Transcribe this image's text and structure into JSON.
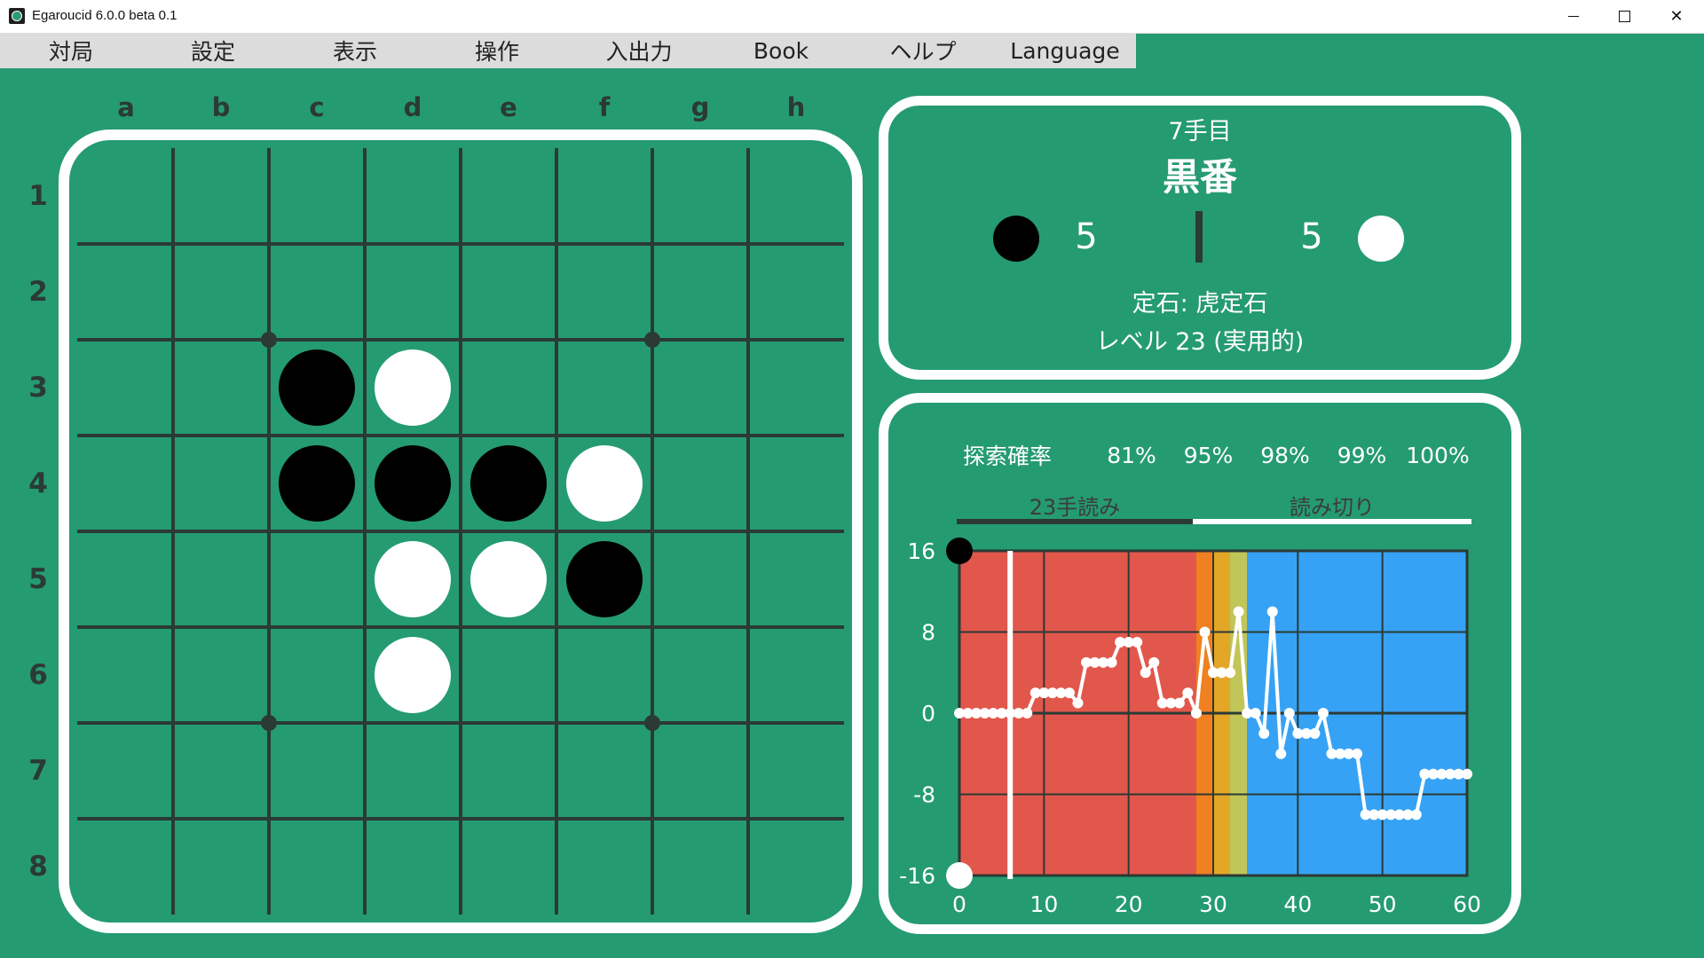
{
  "window": {
    "title": "Egaroucid 6.0.0 beta 0.1",
    "minimize_glyph": "—",
    "maximize_glyph": "☐",
    "close_glyph": "✕"
  },
  "menu": [
    "対局",
    "設定",
    "表示",
    "操作",
    "入出力",
    "Book",
    "ヘルプ",
    "Language"
  ],
  "board": {
    "columns": [
      "a",
      "b",
      "c",
      "d",
      "e",
      "f",
      "g",
      "h"
    ],
    "rows": [
      "1",
      "2",
      "3",
      "4",
      "5",
      "6",
      "7",
      "8"
    ],
    "discs": [
      {
        "cell": "c3",
        "color": "black"
      },
      {
        "cell": "d3",
        "color": "white"
      },
      {
        "cell": "c4",
        "color": "black"
      },
      {
        "cell": "d4",
        "color": "black"
      },
      {
        "cell": "e4",
        "color": "black"
      },
      {
        "cell": "f4",
        "color": "white"
      },
      {
        "cell": "d5",
        "color": "white"
      },
      {
        "cell": "e5",
        "color": "white"
      },
      {
        "cell": "f5",
        "color": "black"
      },
      {
        "cell": "d6",
        "color": "white"
      }
    ],
    "star_points": [
      "c3",
      "g3",
      "c7",
      "g7"
    ]
  },
  "info": {
    "move_number": "7手目",
    "turn": "黒番",
    "black_count": "5",
    "separator": "|",
    "white_count": "5",
    "opening": "定石: 虎定石",
    "level": "レベル 23 (実用的)"
  },
  "legend": [
    {
      "label": "探索確率",
      "color": "#333333"
    },
    {
      "label": "81%",
      "color": "#e2574c"
    },
    {
      "label": "95%",
      "color": "#f08020"
    },
    {
      "label": "98%",
      "color": "#e3a626"
    },
    {
      "label": "99%",
      "color": "#c2c557"
    },
    {
      "label": "100%",
      "color": "#36a2f5"
    }
  ],
  "tabs": [
    {
      "label": "23手読み",
      "active": false
    },
    {
      "label": "読み切り",
      "active": true
    }
  ],
  "colors": {
    "background": "#259b71",
    "grid": "#2b3a34",
    "board_frame": "#ffffff"
  },
  "chart_data": {
    "type": "line",
    "xlim": [
      0,
      60
    ],
    "ylim": [
      -16,
      16
    ],
    "xticks": [
      "0",
      "10",
      "20",
      "30",
      "40",
      "50",
      "60"
    ],
    "yticks": [
      "16",
      "8",
      "0",
      "-8",
      "-16"
    ],
    "current_move": 6,
    "bands": [
      {
        "from": 0,
        "to": 28,
        "color": "#e2574c"
      },
      {
        "from": 28,
        "to": 30,
        "color": "#f08020"
      },
      {
        "from": 30,
        "to": 32,
        "color": "#e3a626"
      },
      {
        "from": 32,
        "to": 34,
        "color": "#c2c557"
      },
      {
        "from": 34,
        "to": 60,
        "color": "#36a2f5"
      }
    ],
    "series": [
      {
        "x": [
          0,
          1,
          2,
          3,
          4,
          5,
          6,
          7,
          8,
          9,
          10,
          11,
          12,
          13,
          14,
          15,
          16,
          17,
          18,
          19,
          20,
          21,
          22,
          23,
          24,
          25,
          26,
          27,
          28,
          29,
          30,
          31,
          32,
          33,
          34,
          35,
          36,
          37,
          38,
          39,
          40,
          41,
          42,
          43,
          44,
          45,
          46,
          47,
          48,
          49,
          50,
          51,
          52,
          53,
          54,
          55,
          56,
          57,
          58,
          59,
          60
        ],
        "y": [
          0,
          0,
          0,
          0,
          0,
          0,
          0,
          0,
          0,
          2,
          2,
          2,
          2,
          2,
          1,
          5,
          5,
          5,
          5,
          7,
          7,
          7,
          4,
          5,
          1,
          1,
          1,
          2,
          0,
          8,
          4,
          4,
          4,
          10,
          0,
          0,
          -2,
          10,
          -4,
          0,
          -2,
          -2,
          -2,
          0,
          -4,
          -4,
          -4,
          -4,
          -10,
          -10,
          -10,
          -10,
          -10,
          -10,
          -10,
          -6,
          -6,
          -6,
          -6,
          -6,
          -6
        ]
      }
    ],
    "endpoints": [
      {
        "value": 16,
        "color": "black"
      },
      {
        "value": -16,
        "color": "white"
      }
    ]
  }
}
